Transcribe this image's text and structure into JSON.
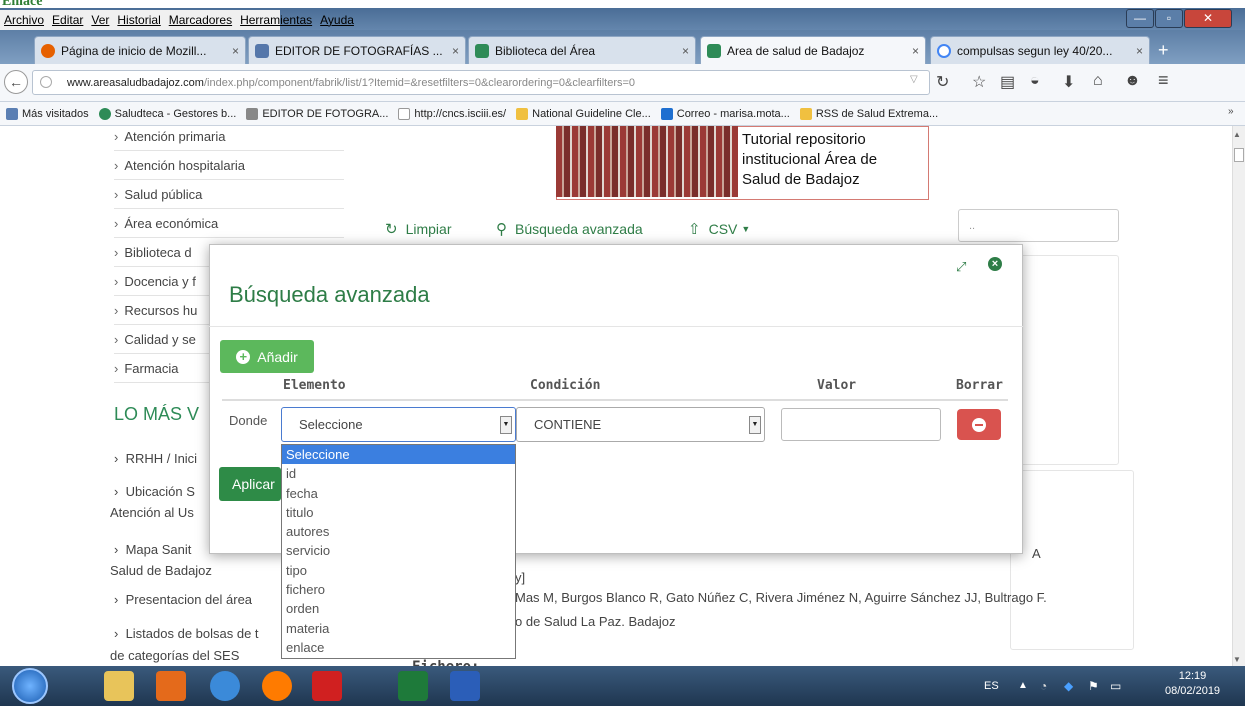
{
  "top_label": "Enlace",
  "menu": [
    "Archivo",
    "Editar",
    "Ver",
    "Historial",
    "Marcadores",
    "Herramientas",
    "Ayuda"
  ],
  "window_controls": {
    "minimize": "—",
    "maximize": "▫",
    "close": "✕"
  },
  "tabs": [
    {
      "label": "Página de inicio de Mozill...",
      "color": "#e66000"
    },
    {
      "label": "EDITOR DE FOTOGRAFÍAS ...",
      "color": "#5577aa"
    },
    {
      "label": "Biblioteca del Área",
      "color": "#2e8b57"
    },
    {
      "label": "Area de salud de Badajoz",
      "color": "#2e8b57"
    },
    {
      "label": "compulsas segun ley 40/20...",
      "color": "#4285f4"
    }
  ],
  "tab_close": "×",
  "new_tab": "+",
  "url": {
    "domain": "www.areasaludbadajoz.com",
    "path": "/index.php/component/fabrik/list/1?Itemid=&resetfilters=0&clearordering=0&clearfilters=0"
  },
  "bookmarks": [
    {
      "label": "Más visitados",
      "color": "#5b7fb3"
    },
    {
      "label": "Saludteca - Gestores b...",
      "color": "#2e8b57"
    },
    {
      "label": "EDITOR DE FOTOGRA...",
      "color": "#888888"
    },
    {
      "label": "http://cncs.isciii.es/",
      "color": "#cccccc"
    },
    {
      "label": "National Guideline Cle...",
      "color": "#f0c040"
    },
    {
      "label": "Correo - marisa.mota...",
      "color": "#1e6fd0"
    },
    {
      "label": "RSS de Salud Extrema...",
      "color": "#f0c040"
    }
  ],
  "sidebar": [
    "Atención primaria",
    "Atención hospitalaria",
    "Salud pública",
    "Área económica",
    "Biblioteca d",
    "Docencia y f",
    "Recursos hu",
    "Calidad y se",
    "Farmacia"
  ],
  "lo_mas": "LO MÁS V",
  "lower_links": [
    {
      "line1": "RRHH / Inici",
      "line2": ""
    },
    {
      "line1": "Ubicación S",
      "line2": "Atención al Us"
    },
    {
      "line1": "Mapa Sanit",
      "line2": "Salud de Badajoz"
    },
    {
      "line1": "Presentacion del área",
      "line2": ""
    },
    {
      "line1": "Listados de bolsas de t",
      "line2": "de categorías del SES"
    }
  ],
  "banner": {
    "line1": "Tutorial  repositorio",
    "line2": "institucional Área de",
    "line3": "Salud de Badajoz"
  },
  "toolbar": {
    "limpiar": "Limpiar",
    "busqueda": "Búsqueda avanzada",
    "csv": "CSV"
  },
  "search_placeholder": "..",
  "modal": {
    "title": "Búsqueda avanzada",
    "add_label": "Añadir",
    "headers": {
      "elemento": "Elemento",
      "condicion": "Condición",
      "valor": "Valor",
      "borrar": "Borrar"
    },
    "donde": "Donde",
    "elemento_value": "Seleccione",
    "condicion_value": "CONTIENE",
    "apply_label": "Aplicar"
  },
  "dropdown_options": [
    "Seleccione",
    "id",
    "fecha",
    "titulo",
    "autores",
    "servicio",
    "tipo",
    "fichero",
    "orden",
    "materia",
    "enlace"
  ],
  "background_text": {
    "fichero": "Fichero:",
    "authors": "Mas M, Burgos Blanco R, Gato Núñez C, Rivera Jiménez N, Aguirre Sánchez JJ, Bultrago F.",
    "center": "o de Salud La Paz. Badajoz",
    "bracket": "y]",
    "a": "A"
  },
  "taskbar": {
    "lang": "ES",
    "time": "12:19",
    "date": "08/02/2019"
  }
}
